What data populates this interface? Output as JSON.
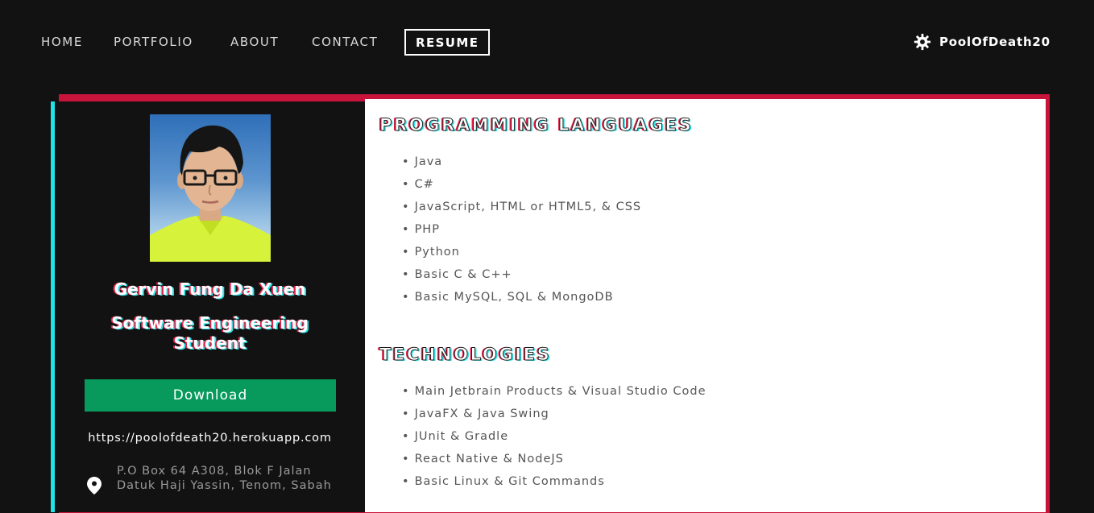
{
  "nav": {
    "items": [
      {
        "label": "HOME",
        "active": false
      },
      {
        "label": "PORTFOLIO",
        "active": false
      },
      {
        "label": "ABOUT",
        "active": false
      },
      {
        "label": "CONTACT",
        "active": false
      },
      {
        "label": "RESUME",
        "active": true
      }
    ],
    "brand": {
      "label": "PoolOfDeath20",
      "icon": "gear-icon"
    }
  },
  "profile": {
    "photo_icon": "profile-photo",
    "name": "Gervin Fung Da Xuen",
    "role": "Software Engineering Student",
    "download_label": "Download",
    "website": "https://poolofdeath20.herokuapp.com",
    "address_icon": "location-pin-icon",
    "address": "P.O Box 64 A308, Blok F Jalan Datuk Haji Yassin, Tenom, Sabah"
  },
  "sections": [
    {
      "title": "PROGRAMMING LANGUAGES",
      "items": [
        "Java",
        "C#",
        "JavaScript, HTML or HTML5, & CSS",
        "PHP",
        "Python",
        "Basic C & C++",
        "Basic MySQL, SQL & MongoDB"
      ]
    },
    {
      "title": "TECHNOLOGIES",
      "items": [
        "Main Jetbrain Products & Visual Studio Code",
        "JavaFX & Java Swing",
        "JUnit & Gradle",
        "React Native & NodeJS",
        "Basic Linux & Git Commands"
      ]
    }
  ],
  "colors": {
    "background": "#121212",
    "accent_red": "#c8143a",
    "accent_cyan": "#22e1e8",
    "download_green": "#079a5c"
  }
}
